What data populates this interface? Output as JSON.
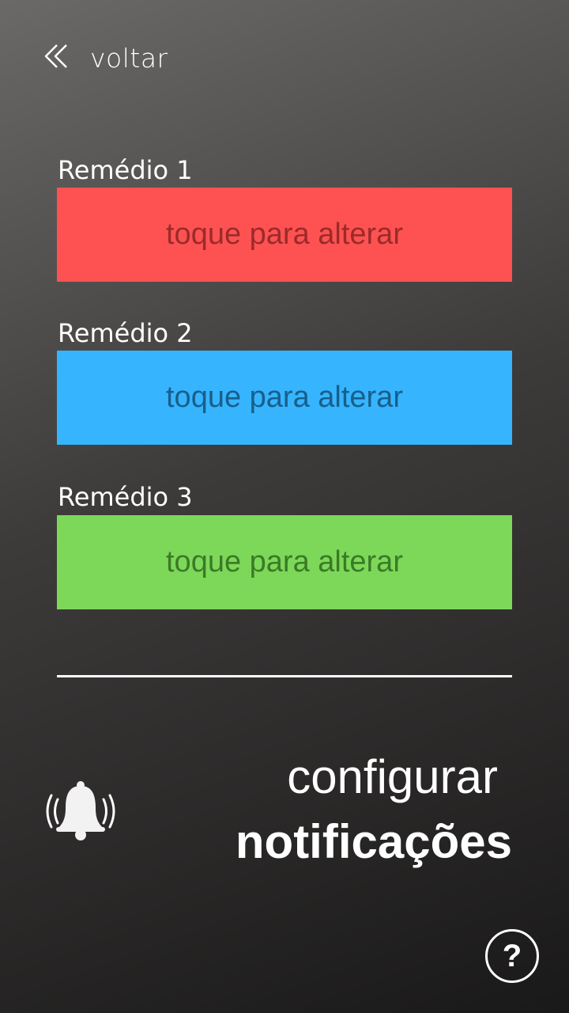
{
  "back": {
    "icon": "double-chevron-left-icon",
    "label": "voltar"
  },
  "medicines": [
    {
      "label": "Remédio 1",
      "button_text": "toque para alterar",
      "color": "#fe5252",
      "text_color": "#9c2a2a"
    },
    {
      "label": "Remédio 2",
      "button_text": "toque para alterar",
      "color": "#37b4fe",
      "text_color": "#175f8c"
    },
    {
      "label": "Remédio 3",
      "button_text": "toque para alterar",
      "color": "#7dd85a",
      "text_color": "#3a7a25"
    }
  ],
  "notifications": {
    "icon": "ringing-bell-icon",
    "line1": "configurar",
    "line2": "notificações"
  },
  "help": {
    "icon": "help-icon",
    "label": "?"
  }
}
